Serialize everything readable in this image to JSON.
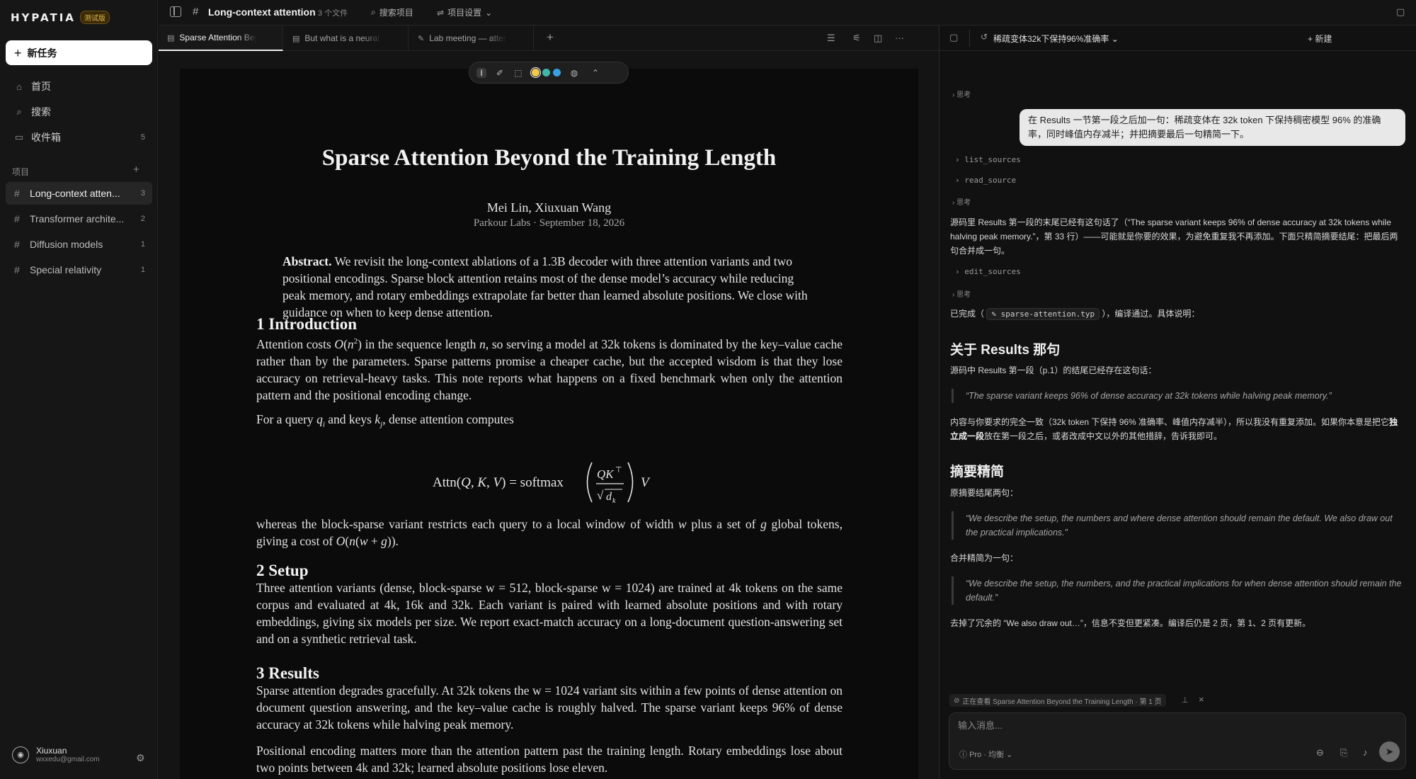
{
  "app": {
    "logo": "HYPATIA",
    "beta": "测试版"
  },
  "sidebar": {
    "new_task": "新任务",
    "nav": [
      {
        "label": "首页",
        "count": ""
      },
      {
        "label": "搜索",
        "count": ""
      },
      {
        "label": "收件箱",
        "count": "5"
      }
    ],
    "projects_label": "项目",
    "projects": [
      {
        "label": "Long-context atten...",
        "count": "3"
      },
      {
        "label": "Transformer archite...",
        "count": "2"
      },
      {
        "label": "Diffusion models",
        "count": "1"
      },
      {
        "label": "Special relativity",
        "count": "1"
      }
    ],
    "user": {
      "name": "Xiuxuan",
      "email": "wxxedu@gmail.com"
    }
  },
  "topbar": {
    "title": "Long-context attention",
    "files": "3 个文件",
    "search": "搜索项目",
    "settings": "项目设置"
  },
  "tabs": [
    {
      "label": "Sparse Attention Beyond"
    },
    {
      "label": "But what is a neural network"
    },
    {
      "label": "Lab meeting — attention"
    }
  ],
  "doc": {
    "title": "Sparse Attention Beyond the Training Length",
    "authors": "Mei Lin, Xiuxuan Wang",
    "affiliation": "Parkour Labs · September 18, 2026",
    "abstract_label": "Abstract.",
    "abstract": "We revisit the long-context ablations of a 1.3B decoder with three attention variants and two positional encodings. Sparse block attention retains most of the dense model’s accuracy while reducing peak memory, and rotary embeddings extrapolate far better than learned absolute positions. We close with guidance on when to keep dense attention.",
    "sec1": "1 Introduction",
    "sec2": "2 Setup",
    "sec2_text": "Three attention variants (dense, block-sparse w = 512, block-sparse w = 1024) are trained at 4k tokens on the same corpus and evaluated at 4k, 16k and 32k. Each variant is paired with learned absolute positions and with rotary embeddings, giving six models per size. We report exact-match accuracy on a long-document question-answering set and on a synthetic retrieval task.",
    "sec3": "3 Results",
    "sec3_text": "Sparse attention degrades gracefully. At 32k tokens the w = 1024 variant sits within a few points of dense attention on document question answering, and the key–value cache is roughly halved. The sparse variant keeps 96% of dense accuracy at 32k tokens while halving peak memory.",
    "sec3_text2": "Positional encoding matters more than the attention pattern past the training length. Rotary embeddings lose about two points between 4k and 32k; learned absolute positions lose eleven."
  },
  "chat": {
    "title": "稀疏变体32k下保持96%准确率",
    "new": "新建",
    "think": "思考",
    "user_msg": "在 Results 一节第一段之后加一句：稀疏变体在 32k token 下保持稠密模型 96% 的准确率，同时峰值内存减半；并把摘要最后一句精简一下。",
    "tool1": "list_sources",
    "tool2": "read_source",
    "tool3": "edit_sources",
    "reply1": "源码里 Results 第一段的末尾已经有这句话了（“The sparse variant keeps 96% of dense accuracy at 32k tokens while halving peak memory.”，第 33 行）——可能就是你要的效果，为避免重复我不再添加。下面只精简摘要结尾：把最后两句合并成一句。",
    "done_pre": "已完成（",
    "done_file": "sparse-attention.typ",
    "done_post": "），编译通过。具体说明：",
    "h1": "关于 Results 那句",
    "p1": "源码中 Results 第一段（p.1）的结尾已经存在这句话：",
    "q1": "“The sparse variant keeps 96% of dense accuracy at 32k tokens while halving peak memory.”",
    "p2_a": "内容与你要求的完全一致（32k token 下保持 96% 准确率、峰值内存减半），所以我没有重复添加。如果你本意是把它",
    "p2_b": "独立成一段",
    "p2_c": "放在第一段之后，或者改成中文以外的其他措辞，告诉我即可。",
    "h2": "摘要精简",
    "p3": "原摘要结尾两句：",
    "q2": "“We describe the setup, the numbers and where dense attention should remain the default. We also draw out the practical implications.”",
    "p4": "合并精简为一句：",
    "q3": "“We describe the setup, the numbers, and the practical implications for when dense attention should remain the default.”",
    "p5": "去掉了冗余的 “We also draw out…”，信息不变但更紧凑。编译后仍是 2 页，第 1、2 页有更新。",
    "context": "正在查看 Sparse Attention Beyond the Training Length · 第 1 页",
    "input_placeholder": "输入消息...",
    "mode": "Pro · 均衡"
  },
  "colors": {
    "accent_yellow": "#f2c94c",
    "accent_teal": "#3fb6a8",
    "accent_blue": "#3aa0e0"
  }
}
